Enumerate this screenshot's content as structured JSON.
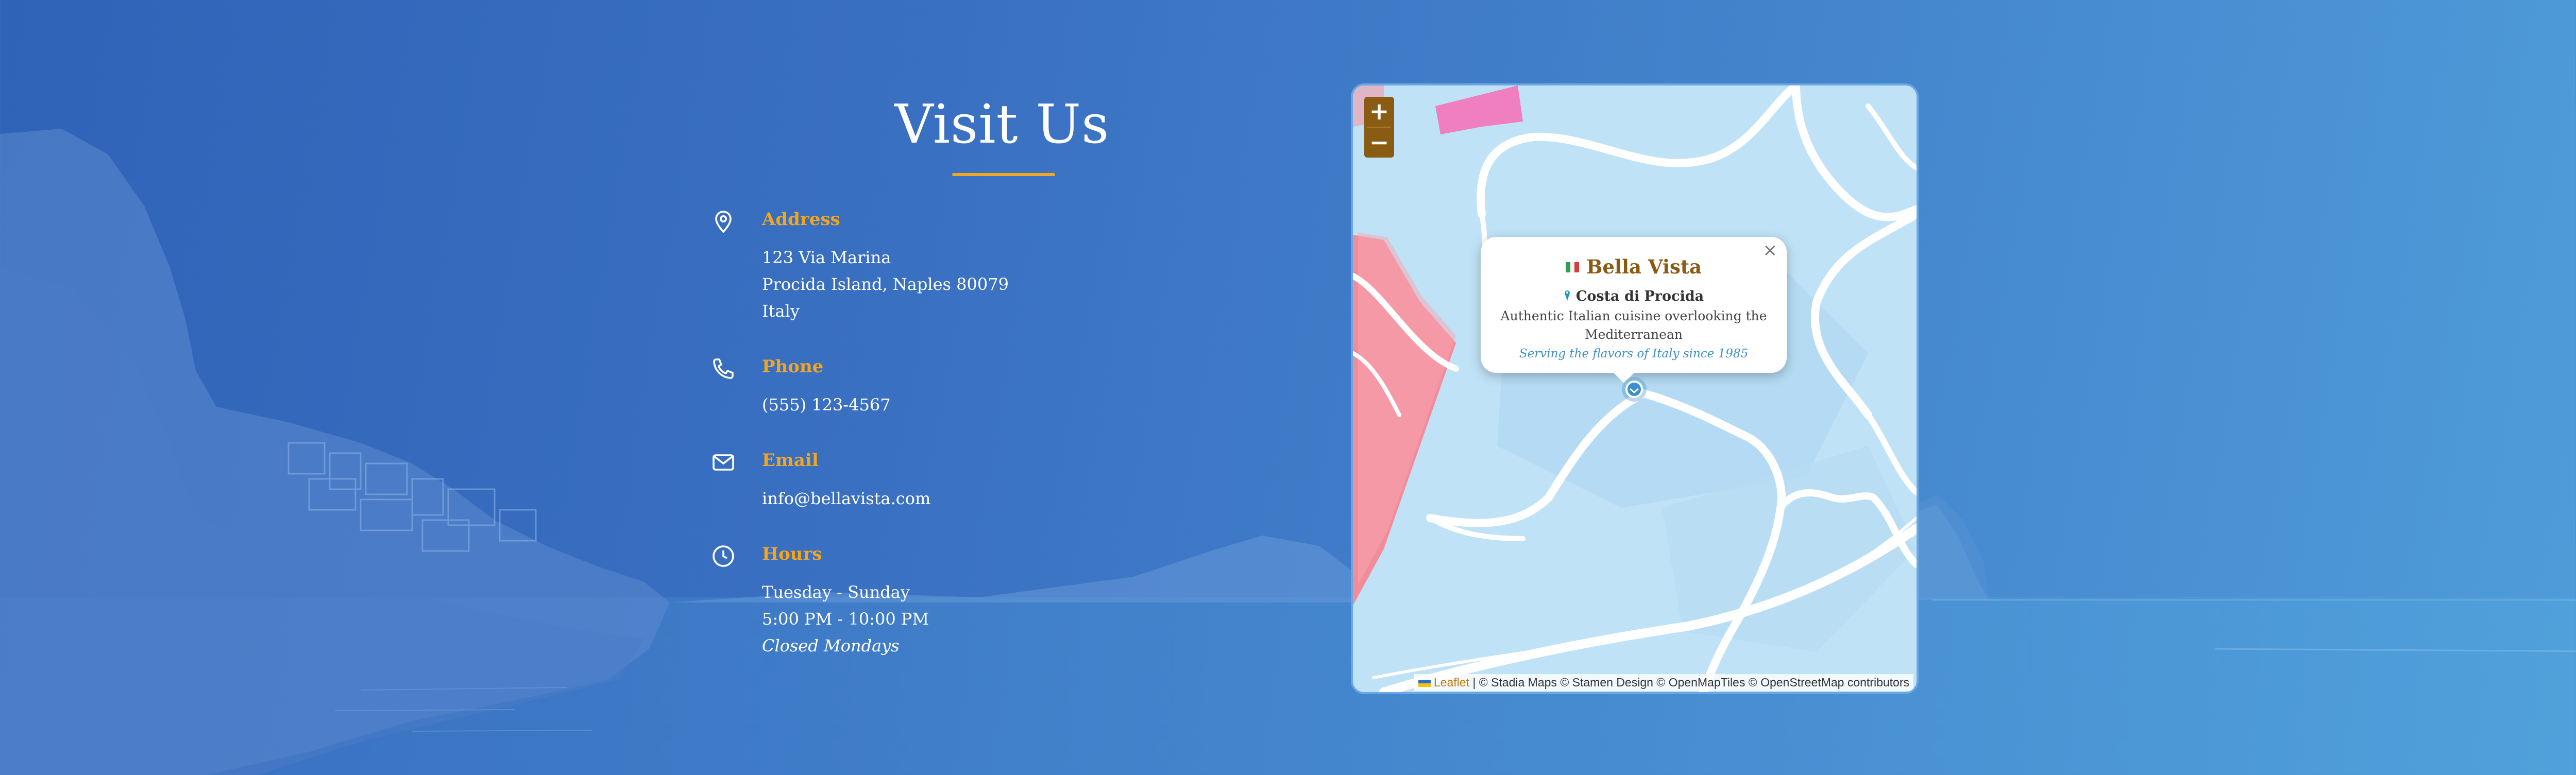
{
  "section": {
    "title": "Visit Us"
  },
  "contact": {
    "address": {
      "label": "Address",
      "icon": "map-pin-icon",
      "lines": [
        "123 Via Marina",
        "Procida Island, Naples 80079",
        "Italy"
      ]
    },
    "phone": {
      "label": "Phone",
      "icon": "phone-icon",
      "lines": [
        "(555) 123-4567"
      ]
    },
    "email": {
      "label": "Email",
      "icon": "mail-icon",
      "lines": [
        "info@bellavista.com"
      ]
    },
    "hours": {
      "label": "Hours",
      "icon": "clock-icon",
      "lines": [
        "Tuesday - Sunday",
        "5:00 PM - 10:00 PM"
      ],
      "note": "Closed Mondays"
    }
  },
  "map": {
    "zoom_in": "+",
    "zoom_out": "−",
    "popup": {
      "close": "×",
      "title": "Bella Vista",
      "location": "Costa di Procida",
      "description": "Authentic Italian cuisine overlooking the Mediterranean",
      "tagline": "Serving the flavors of Italy since 1985"
    },
    "attribution": {
      "leaflet": "Leaflet",
      "credits": "| © Stadia Maps © Stamen Design © OpenMapTiles © OpenStreetMap contributors"
    }
  },
  "colors": {
    "accent": "#f2a51e",
    "brand": "#8a5b12",
    "link": "#3d8fcc",
    "map_water": "#bfe2f6",
    "map_land": "#f28c9a"
  }
}
